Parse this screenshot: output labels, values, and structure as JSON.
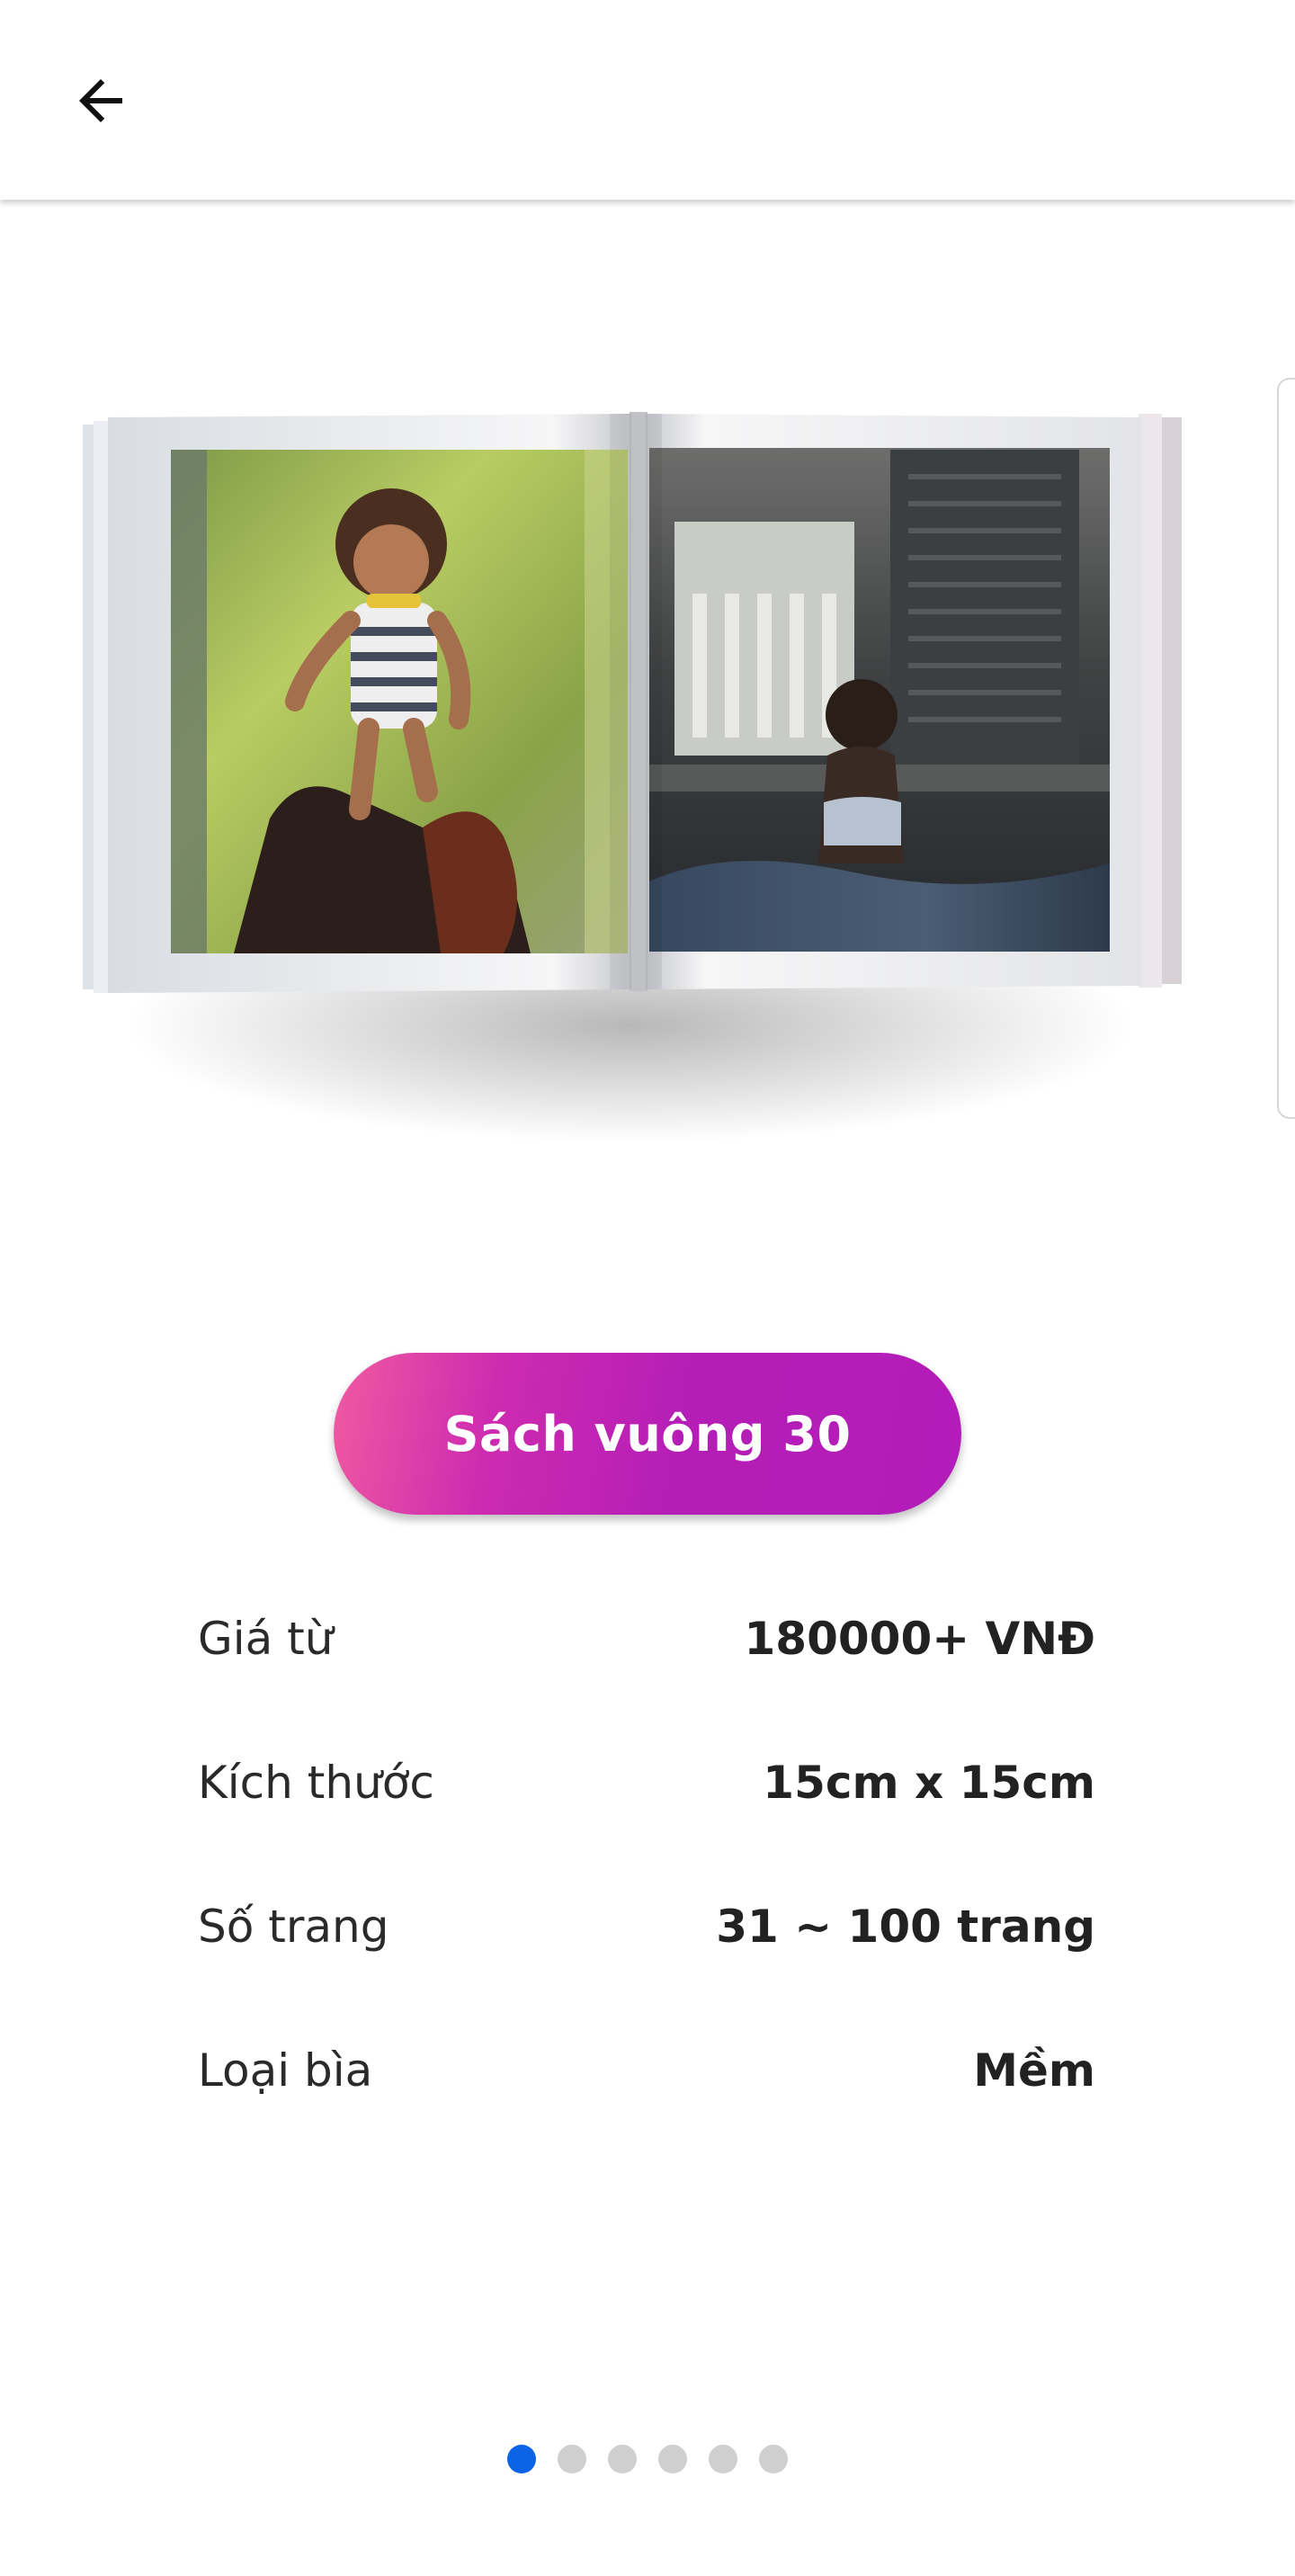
{
  "header": {
    "back_icon": "arrow-left-icon"
  },
  "product": {
    "image_alt": "Open square photo book",
    "title": "Sách vuông 30"
  },
  "details": [
    {
      "label": "Giá từ",
      "value": "180000+ VNĐ"
    },
    {
      "label": "Kích thước",
      "value": "15cm x 15cm"
    },
    {
      "label": "Số trang",
      "value": "31 ~ 100 trang"
    },
    {
      "label": "Loại bìa",
      "value": "Mềm"
    }
  ],
  "pagination": {
    "total": 6,
    "current": 1
  },
  "colors": {
    "accent_gradient_start": "#f05aa0",
    "accent_gradient_end": "#b31cb8",
    "active_dot": "#0b63e5",
    "inactive_dot": "#cfcfcf"
  }
}
